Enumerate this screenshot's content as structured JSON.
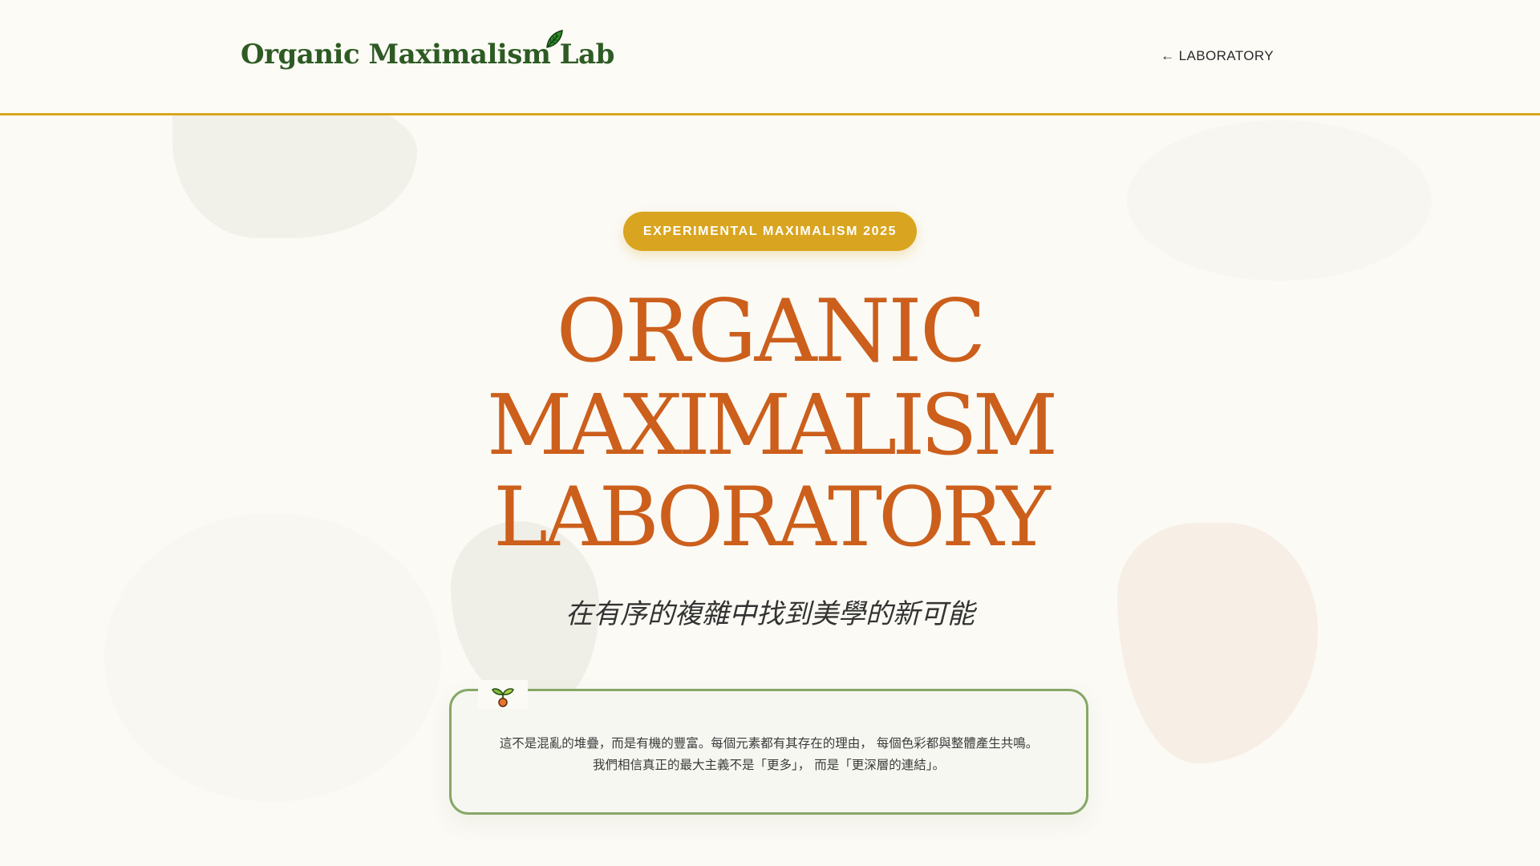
{
  "header": {
    "brand": "Organic Maximalism Lab",
    "brand_icon": "leaf-icon",
    "back_link": "← LABORATORY"
  },
  "hero": {
    "badge": "EXPERIMENTAL MAXIMALISM 2025",
    "title_lines": [
      "ORGANIC",
      "MAXIMALISM",
      "LABORATORY"
    ],
    "subtitle": "在有序的複雜中找到美學的新可能",
    "card": {
      "icon": "sprout-icon",
      "lines": [
        "這不是混亂的堆疊，而是有機的豐富。每個元素都有其存在的理由， 每個色彩都與整體產生共鳴。",
        "我們相信真正的最大主義不是「更多」， 而是「更深層的連結」。"
      ]
    }
  },
  "colors": {
    "background": "#fbfaf5",
    "brand_green": "#2e5b24",
    "accent_gold": "#d9a520",
    "title_orange": "#cc5f1c",
    "card_border": "#86a866"
  }
}
